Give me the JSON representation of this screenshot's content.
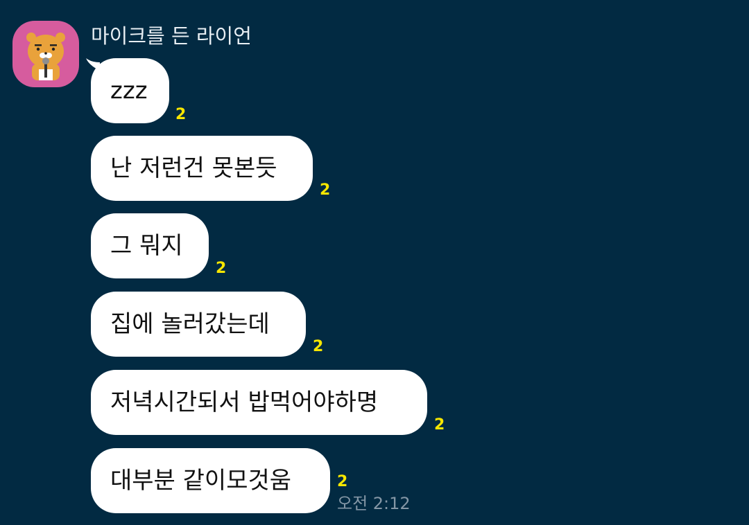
{
  "chat": {
    "sender_name": "마이크를 든 라이언",
    "avatar_icon": "ryan-with-microphone-icon",
    "avatar_bg": "#d65c9e",
    "background": "#022a42",
    "unread_color": "#f7e600",
    "messages": [
      {
        "text": "zzz",
        "unread": "2"
      },
      {
        "text": "난 저런건 못본듯",
        "unread": "2"
      },
      {
        "text": "그 뭐지",
        "unread": "2"
      },
      {
        "text": "집에 놀러갔는데",
        "unread": "2"
      },
      {
        "text": "저녁시간되서 밥먹어야하명",
        "unread": "2"
      },
      {
        "text": "대부분 같이모것움",
        "unread": "2"
      }
    ],
    "last_timestamp": "오전 2:12"
  }
}
